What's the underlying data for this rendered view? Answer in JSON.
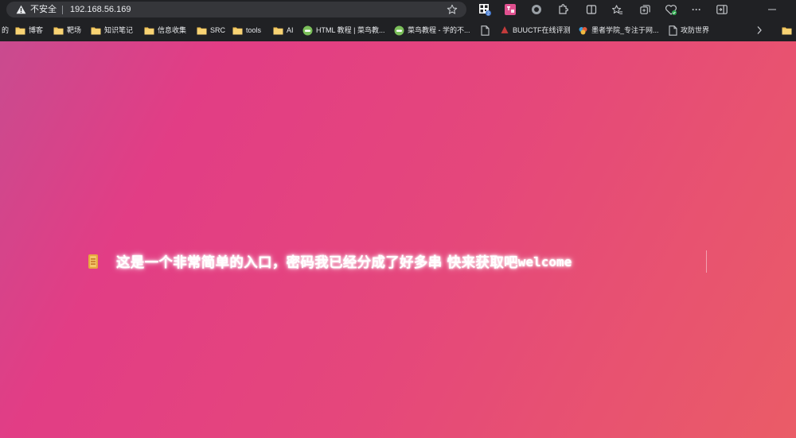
{
  "browser": {
    "security_label": "不安全",
    "url": "192.168.56.169"
  },
  "toolbar": {
    "extension_badge": "2",
    "more_label": "···"
  },
  "bookmarks": {
    "partial_label": "的",
    "items": [
      {
        "label": "博客",
        "icon": "folder-icon"
      },
      {
        "label": "靶场",
        "icon": "folder-icon"
      },
      {
        "label": "知识笔记",
        "icon": "folder-icon"
      },
      {
        "label": "信息收集",
        "icon": "folder-icon"
      },
      {
        "label": "SRC",
        "icon": "folder-icon"
      },
      {
        "label": "tools",
        "icon": "folder-icon"
      },
      {
        "label": "AI",
        "icon": "folder-icon"
      },
      {
        "label": "HTML 教程 | 菜鸟教...",
        "icon": "runoob-icon"
      },
      {
        "label": "菜鸟教程 - 学的不...",
        "icon": "runoob-icon"
      },
      {
        "label": "",
        "icon": "page-icon"
      },
      {
        "label": "BUUCTF在线评测",
        "icon": "buuctf-icon"
      },
      {
        "label": "墨者学院_专注于网...",
        "icon": "mozhe-icon"
      },
      {
        "label": "攻防世界",
        "icon": "page-icon"
      }
    ]
  },
  "page": {
    "message": "这是一个非常简单的入口，密码我已经分成了好多串 快来获取吧",
    "message_suffix": "welcome"
  },
  "colors": {
    "chrome_bg": "#202124",
    "gradient_start": "#c94b8f",
    "gradient_mid": "#e23d85",
    "gradient_end": "#ea5c67",
    "text": "#ffffff"
  }
}
